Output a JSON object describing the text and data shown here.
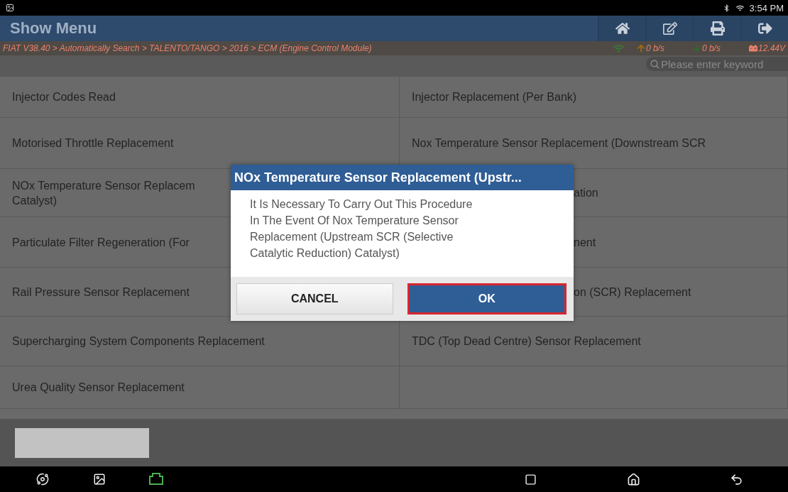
{
  "status_bar": {
    "time": "3:54 PM"
  },
  "header": {
    "title": "Show Menu",
    "buttons": [
      {
        "kind": "home"
      },
      {
        "kind": "edit"
      },
      {
        "kind": "print"
      },
      {
        "kind": "exit"
      }
    ]
  },
  "breadcrumb": {
    "path": "FIAT V38.40 > Automatically Search > TALENTO/TANGO > 2016 > ECM (Engine Control Module)",
    "upload": "0 b/s",
    "download": "0 b/s",
    "voltage": "12.44V"
  },
  "search": {
    "placeholder": "Please enter keyword"
  },
  "menu": [
    {
      "left": {
        "kind": "full",
        "lines": [
          "Injector Codes Read"
        ]
      },
      "right": {
        "kind": "full",
        "lines": [
          "Injector Replacement (Per Bank)"
        ]
      }
    },
    {
      "left": {
        "kind": "full",
        "lines": [
          "Motorised Throttle Replacement"
        ]
      },
      "right": {
        "kind": "full",
        "lines": [
          "Nox Temperature Sensor Replacement (Downstream SCR"
        ]
      }
    },
    {
      "left": {
        "kind": "full",
        "lines": [
          "NOx Temperature Sensor Replacem",
          "Catalyst)"
        ]
      },
      "right": {
        "kind": "tail",
        "lines": [
          "ation"
        ]
      }
    },
    {
      "left": {
        "kind": "full",
        "lines": [
          "Particulate Filter Regeneration (For"
        ]
      },
      "right": {
        "kind": "tail",
        "lines": [
          "nent"
        ]
      }
    },
    {
      "left": {
        "kind": "full",
        "lines": [
          "Rail Pressure Sensor Replacement"
        ]
      },
      "right": {
        "kind": "tail",
        "lines": [
          "on (SCR) Replacement"
        ]
      }
    },
    {
      "left": {
        "kind": "full",
        "lines": [
          "Supercharging System Components Replacement"
        ]
      },
      "right": {
        "kind": "full",
        "lines": [
          "TDC (Top Dead Centre) Sensor Replacement"
        ]
      }
    },
    {
      "left": {
        "kind": "full",
        "lines": [
          "Urea Quality Sensor Replacement"
        ]
      },
      "right": {
        "kind": "empty"
      }
    }
  ],
  "dialog": {
    "title": "NOx Temperature Sensor Replacement (Upstr...",
    "message": "It Is Necessary To Carry Out This Procedure In The Event Of Nox Temperature Sensor Replacement (Upstream SCR (Selective Catalytic Reduction) Catalyst)",
    "buttons": [
      {
        "label": "CANCEL",
        "selected": false
      },
      {
        "label": "OK",
        "selected": true
      }
    ]
  },
  "nav_bar": {
    "left": [
      {
        "kind": "browser"
      },
      {
        "kind": "gallery"
      },
      {
        "kind": "vci"
      }
    ],
    "right": [
      {
        "kind": "recents"
      },
      {
        "kind": "home"
      },
      {
        "kind": "back"
      }
    ]
  }
}
